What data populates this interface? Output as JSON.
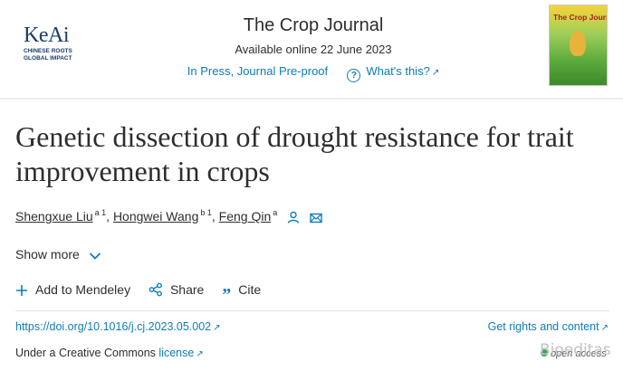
{
  "publisher": {
    "name": "KeAi",
    "tagline_line1": "CHINESE ROOTS",
    "tagline_line2": "GLOBAL IMPACT"
  },
  "journal": {
    "title": "The Crop Journal",
    "available": "Available online 22 June 2023",
    "status": "In Press, Journal Pre-proof",
    "whats_this": "What's this?",
    "cover_text": "The Crop Journal"
  },
  "article": {
    "title": "Genetic dissection of drought resistance for trait improvement in crops",
    "authors": [
      {
        "name": "Shengxue Liu",
        "sup": "a 1"
      },
      {
        "name": "Hongwei Wang",
        "sup": "b 1"
      },
      {
        "name": "Feng Qin",
        "sup": "a"
      }
    ],
    "show_more": "Show more"
  },
  "actions": {
    "mendeley": "Add to Mendeley",
    "share": "Share",
    "cite": "Cite"
  },
  "links": {
    "doi": "https://doi.org/10.1016/j.cj.2023.05.002",
    "rights": "Get rights and content",
    "license_prefix": "Under a Creative Commons",
    "license_link": "license",
    "open_access": "open access"
  },
  "watermark": "Bioeditas",
  "icons": {
    "person": "person-icon",
    "mail": "mail-icon",
    "chevron": "chevron-down-icon",
    "plus": "plus-icon",
    "share": "share-icon",
    "cite": "quote-icon",
    "external": "external-link-icon",
    "help": "question-circle-icon"
  },
  "colors": {
    "link": "#0c7dbb",
    "text": "#2e2e2e",
    "logo": "#1c3d6e",
    "open_access_dot": "#3aa756"
  }
}
